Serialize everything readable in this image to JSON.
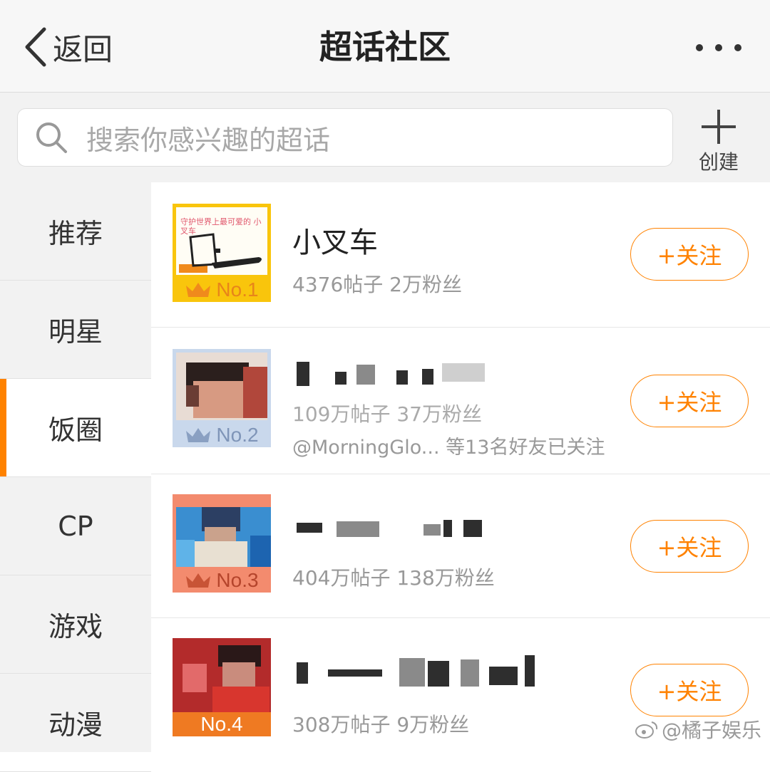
{
  "header": {
    "back_label": "返回",
    "title": "超话社区"
  },
  "search": {
    "placeholder": "搜索你感兴趣的超话",
    "create_label": "创建"
  },
  "sidebar": {
    "items": [
      {
        "label": "推荐"
      },
      {
        "label": "明星"
      },
      {
        "label": "饭圈",
        "active": true
      },
      {
        "label": "CP"
      },
      {
        "label": "游戏"
      },
      {
        "label": "动漫"
      }
    ]
  },
  "list": {
    "items": [
      {
        "rank": "No.1",
        "name": "小叉车",
        "stats": "4376帖子  2万粉丝",
        "thumb_text": "守护世界上最可爱的 小叉车",
        "follow_label": "+关注"
      },
      {
        "rank": "No.2",
        "stats": "109万帖子  37万粉丝",
        "friends": "@MorningGlo... 等13名好友已关注",
        "follow_label": "+关注"
      },
      {
        "rank": "No.3",
        "stats": "404万帖子  138万粉丝",
        "follow_label": "+关注"
      },
      {
        "rank": "No.4",
        "stats": "308万帖子  9万粉丝",
        "follow_label": "+关注"
      }
    ]
  },
  "watermark": "@橘子娱乐",
  "colors": {
    "accent": "#ff8200",
    "rank1_bg": "#f9c50c",
    "rank2_bg": "#c9d8ec",
    "rank3_bg": "#f38b6e",
    "rank4_bg": "#ef7a22"
  }
}
